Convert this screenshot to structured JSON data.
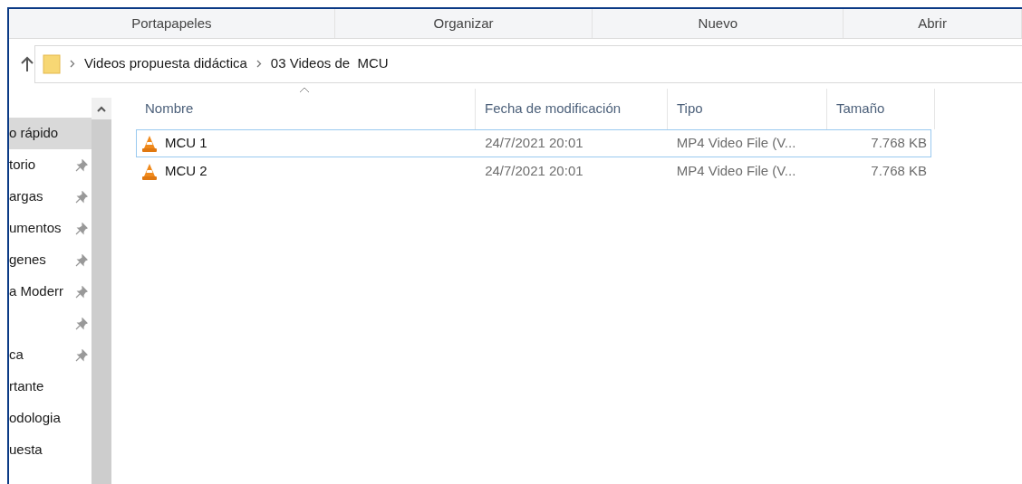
{
  "ribbon_groups": [
    "Portapapeles",
    "Organizar",
    "Nuevo",
    "Abrir"
  ],
  "breadcrumb": [
    "Videos propuesta didáctica",
    "03 Videos de  MCU"
  ],
  "sidebar": {
    "items": [
      {
        "label": "o rápido",
        "pinned": false,
        "selected": true
      },
      {
        "label": "torio",
        "pinned": true,
        "selected": false
      },
      {
        "label": "argas",
        "pinned": true,
        "selected": false
      },
      {
        "label": "umentos",
        "pinned": true,
        "selected": false
      },
      {
        "label": "genes",
        "pinned": true,
        "selected": false
      },
      {
        "label": "a Moderr",
        "pinned": true,
        "selected": false
      },
      {
        "pinned": true,
        "selected": false
      },
      {
        "label": "ca",
        "pinned": true,
        "selected": false
      },
      {
        "label": "rtante",
        "pinned": false,
        "selected": false
      },
      {
        "label": "odologia",
        "pinned": false,
        "selected": false
      },
      {
        "label": "uesta",
        "pinned": false,
        "selected": false
      }
    ]
  },
  "table": {
    "columns": [
      "Nombre",
      "Fecha de modificación",
      "Tipo",
      "Tamaño"
    ],
    "rows": [
      {
        "name": "MCU 1",
        "modified": "24/7/2021 20:01",
        "type": "MP4 Video File (V...",
        "size": "7.768 KB",
        "focused": true
      },
      {
        "name": "MCU 2",
        "modified": "24/7/2021 20:01",
        "type": "MP4 Video File (V...",
        "size": "7.768 KB",
        "focused": false
      }
    ]
  }
}
